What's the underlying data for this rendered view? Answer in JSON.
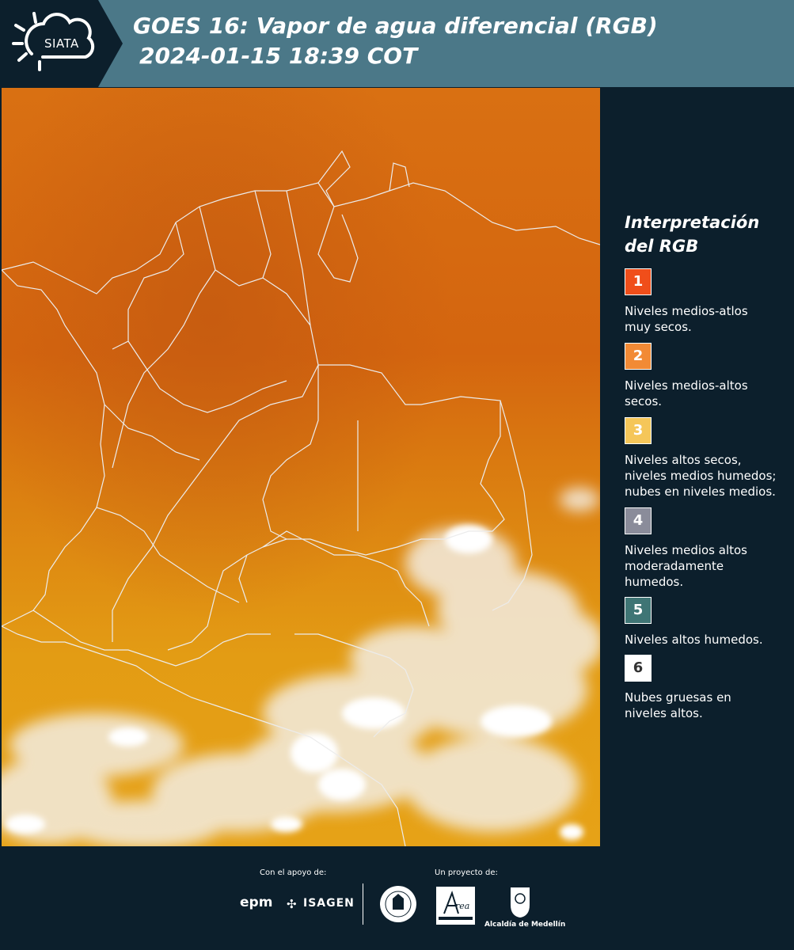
{
  "header": {
    "logo_text": "SIATA",
    "title_line1": "GOES 16: Vapor de agua diferencial (RGB)",
    "title_line2": "2024-01-15 18:39 COT"
  },
  "legend": {
    "title_line1": "Interpretación",
    "title_line2": "del RGB",
    "items": [
      {
        "number": "1",
        "color": "#f04e1a",
        "text_lines": [
          "Niveles medios-atlos",
          "muy secos."
        ]
      },
      {
        "number": "2",
        "color": "#f28a35",
        "text_lines": [
          "Niveles medios-altos",
          "secos."
        ]
      },
      {
        "number": "3",
        "color": "#f5c659",
        "text_lines": [
          "Niveles altos secos,",
          "niveles medios humedos;",
          "nubes en niveles medios."
        ]
      },
      {
        "number": "4",
        "color": "#8a8c9a",
        "text_lines": [
          "Niveles medios altos",
          "moderadamente",
          "humedos."
        ]
      },
      {
        "number": "5",
        "color": "#3f7575",
        "text_lines": [
          "Niveles altos humedos."
        ]
      },
      {
        "number": "6",
        "color": "#ffffff",
        "text_lines": [
          "Nubes gruesas en",
          "niveles altos."
        ]
      }
    ]
  },
  "footer": {
    "support_label": "Con el apoyo de:",
    "project_label": "Un proyecto de:",
    "sponsor_1": "epm",
    "sponsor_2": "ISAGEN",
    "partner_area": "Área Metropolitana",
    "partner_alcaldia": "Alcaldía de Medellín"
  },
  "map": {
    "description_colors": {
      "dry": "#d86a10",
      "moist": "#e29a12",
      "cloud": "#f5f1ea",
      "border": "#e8e8e8"
    }
  }
}
